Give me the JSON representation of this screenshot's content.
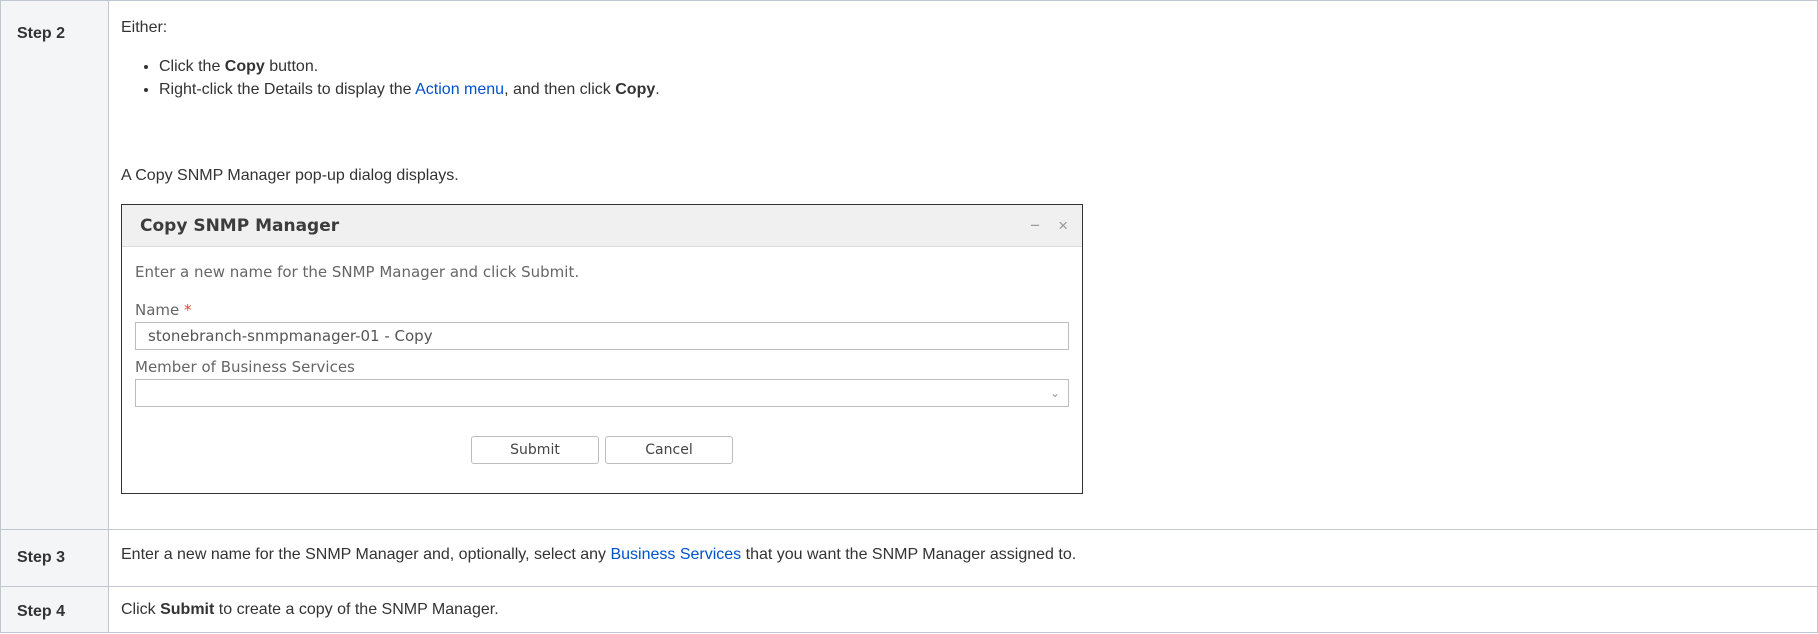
{
  "steps": [
    {
      "label": "Step 2",
      "intro": "Either:",
      "bullets": [
        {
          "pre": "Click the ",
          "bold": "Copy",
          "post": " button."
        },
        {
          "pre": "Right-click the Details to display the ",
          "link": "Action menu",
          "mid": ", and then click ",
          "bold": "Copy",
          "post": "."
        }
      ],
      "after": "A Copy SNMP Manager pop-up dialog displays."
    },
    {
      "label": "Step 3",
      "pre": "Enter a new name for the SNMP Manager and, optionally, select any ",
      "link": "Business Services",
      "post": " that you want the SNMP Manager assigned to."
    },
    {
      "label": "Step 4",
      "pre": "Click ",
      "bold": "Submit",
      "post": " to create a copy of the SNMP Manager."
    }
  ],
  "dialog": {
    "title": "Copy SNMP Manager",
    "minimize_glyph": "−",
    "close_glyph": "×",
    "instruction": "Enter a new name for the SNMP Manager and click Submit.",
    "name_label": "Name",
    "required_marker": "*",
    "name_value": "stonebranch-snmpmanager-01 - Copy",
    "business_services_label": "Member of Business Services",
    "business_services_value": "",
    "dropdown_glyph": "⌄",
    "submit_label": "Submit",
    "cancel_label": "Cancel"
  },
  "colors": {
    "link": "#0052cc",
    "required": "#e0462f",
    "step_label_bg": "#f4f5f7",
    "dialog_header_bg": "#f0f0f0"
  }
}
